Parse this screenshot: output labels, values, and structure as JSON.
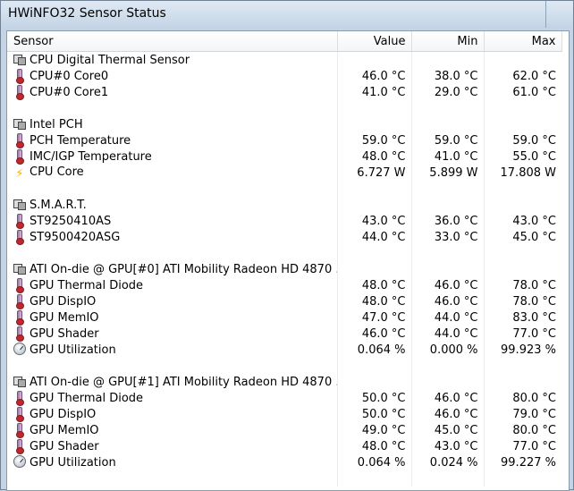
{
  "window": {
    "title": "HWiNFO32 Sensor Status"
  },
  "table": {
    "headers": [
      "Sensor",
      "Value",
      "Min",
      "Max"
    ],
    "rows": [
      {
        "kind": "group",
        "icon": "chip-icon",
        "sensor": "CPU Digital Thermal Sensor"
      },
      {
        "kind": "item",
        "icon": "thermometer-icon",
        "sensor": "CPU#0 Core0",
        "value": "46.0 °C",
        "min": "38.0 °C",
        "max": "62.0 °C"
      },
      {
        "kind": "item",
        "icon": "thermometer-icon",
        "sensor": "CPU#0 Core1",
        "value": "41.0 °C",
        "min": "29.0 °C",
        "max": "61.0 °C"
      },
      {
        "kind": "blank"
      },
      {
        "kind": "group",
        "icon": "chip-icon",
        "sensor": "Intel PCH"
      },
      {
        "kind": "item",
        "icon": "thermometer-icon",
        "sensor": "PCH Temperature",
        "value": "59.0 °C",
        "min": "59.0 °C",
        "max": "59.0 °C"
      },
      {
        "kind": "item",
        "icon": "thermometer-icon",
        "sensor": "IMC/IGP Temperature",
        "value": "48.0 °C",
        "min": "41.0 °C",
        "max": "55.0 °C"
      },
      {
        "kind": "item",
        "icon": "lightning-icon",
        "sensor": "CPU Core",
        "value": "6.727 W",
        "min": "5.899 W",
        "max": "17.808 W"
      },
      {
        "kind": "blank"
      },
      {
        "kind": "group",
        "icon": "chip-icon",
        "sensor": "S.M.A.R.T."
      },
      {
        "kind": "item",
        "icon": "thermometer-icon",
        "sensor": "ST9250410AS",
        "value": "43.0 °C",
        "min": "36.0 °C",
        "max": "43.0 °C"
      },
      {
        "kind": "item",
        "icon": "thermometer-icon",
        "sensor": "ST9500420ASG",
        "value": "44.0 °C",
        "min": "33.0 °C",
        "max": "45.0 °C"
      },
      {
        "kind": "blank"
      },
      {
        "kind": "group",
        "icon": "chip-icon",
        "sensor": "ATI On-die @ GPU[#0] ATI Mobility Radeon HD 4870 ..."
      },
      {
        "kind": "item",
        "icon": "thermometer-icon",
        "sensor": "GPU Thermal Diode",
        "value": "48.0 °C",
        "min": "46.0 °C",
        "max": "78.0 °C"
      },
      {
        "kind": "item",
        "icon": "thermometer-icon",
        "sensor": "GPU DispIO",
        "value": "48.0 °C",
        "min": "46.0 °C",
        "max": "78.0 °C"
      },
      {
        "kind": "item",
        "icon": "thermometer-icon",
        "sensor": "GPU MemIO",
        "value": "47.0 °C",
        "min": "44.0 °C",
        "max": "83.0 °C"
      },
      {
        "kind": "item",
        "icon": "thermometer-icon",
        "sensor": "GPU Shader",
        "value": "46.0 °C",
        "min": "44.0 °C",
        "max": "77.0 °C"
      },
      {
        "kind": "item",
        "icon": "gauge-icon",
        "sensor": "GPU Utilization",
        "value": "0.064 %",
        "min": "0.000 %",
        "max": "99.923 %"
      },
      {
        "kind": "blank"
      },
      {
        "kind": "group",
        "icon": "chip-icon",
        "sensor": "ATI On-die @ GPU[#1] ATI Mobility Radeon HD 4870 ..."
      },
      {
        "kind": "item",
        "icon": "thermometer-icon",
        "sensor": "GPU Thermal Diode",
        "value": "50.0 °C",
        "min": "46.0 °C",
        "max": "80.0 °C"
      },
      {
        "kind": "item",
        "icon": "thermometer-icon",
        "sensor": "GPU DispIO",
        "value": "50.0 °C",
        "min": "46.0 °C",
        "max": "79.0 °C"
      },
      {
        "kind": "item",
        "icon": "thermometer-icon",
        "sensor": "GPU MemIO",
        "value": "49.0 °C",
        "min": "45.0 °C",
        "max": "80.0 °C"
      },
      {
        "kind": "item",
        "icon": "thermometer-icon",
        "sensor": "GPU Shader",
        "value": "48.0 °C",
        "min": "43.0 °C",
        "max": "77.0 °C"
      },
      {
        "kind": "item",
        "icon": "gauge-icon",
        "sensor": "GPU Utilization",
        "value": "0.064 %",
        "min": "0.024 %",
        "max": "99.227 %"
      },
      {
        "kind": "blank"
      }
    ]
  }
}
